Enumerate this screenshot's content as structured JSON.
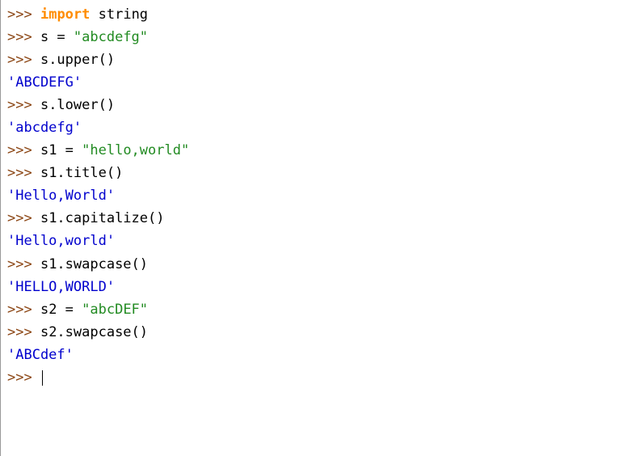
{
  "prompt": ">>>",
  "lines": {
    "l1_kw": "import",
    "l1_mod": " string",
    "l2_code": " s = ",
    "l2_str": "\"abcdefg\"",
    "l3_code": " s.upper()",
    "l4_out": "'ABCDEFG'",
    "l5_code": " s.lower()",
    "l6_out": "'abcdefg'",
    "l7_code": " s1 = ",
    "l7_str": "\"hello,world\"",
    "l8_code": " s1.title()",
    "l9_out": "'Hello,World'",
    "l10_code": " s1.capitalize()",
    "l11_out": "'Hello,world'",
    "l12_code": " s1.swapcase()",
    "l13_out": "'HELLO,WORLD'",
    "l14_code": " s2 = ",
    "l14_str": "\"abcDEF\"",
    "l15_code": " s2.swapcase()",
    "l16_out": "'ABCdef'",
    "l17_code": " "
  }
}
